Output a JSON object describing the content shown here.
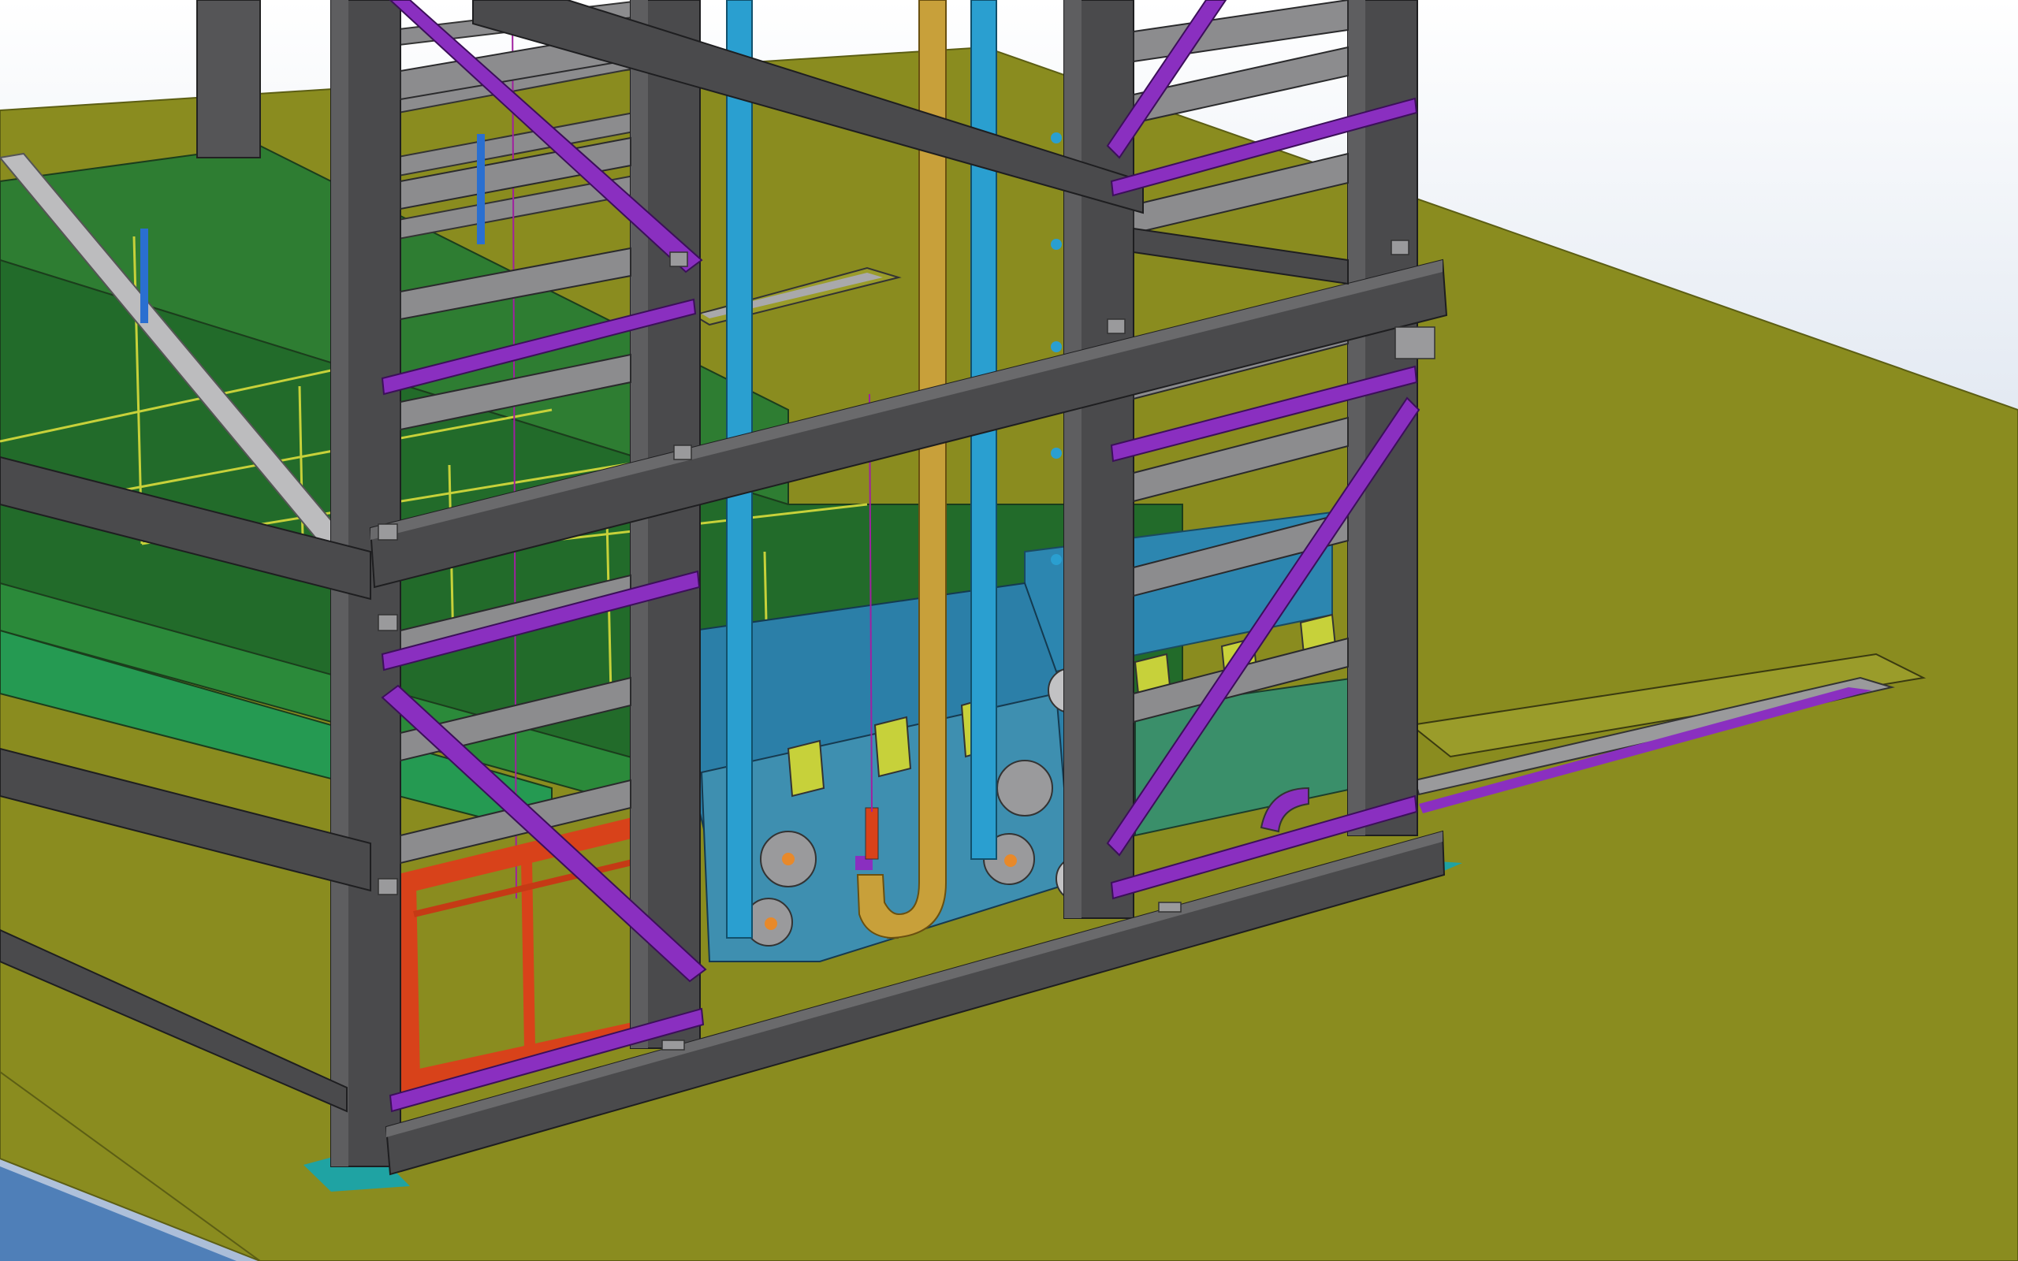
{
  "viewport": {
    "description_visible": false,
    "colors": {
      "sky_top": "#ffffff",
      "sky_bottom": "#a8bcd8",
      "floor": "#8a8c1f",
      "floor_edge": "#6f7118",
      "steel": "#4a4a4c",
      "steel_dark": "#2e2e30",
      "steel_light": "#808082",
      "gray_member": "#8c8c8e",
      "purple_brace": "#8a2fc0",
      "green_tank": "#2e7d32",
      "green_tank_dark": "#1b5e20",
      "blue_panel": "#2c86b0",
      "cyan_pillar": "#2a9fd0",
      "gold_pillar": "#c8a03a",
      "orange_frame": "#d8421a",
      "lime_flap": "#c7d13a",
      "teal_pad": "#1fa3a3",
      "gear_gray": "#9a9a9c"
    }
  }
}
